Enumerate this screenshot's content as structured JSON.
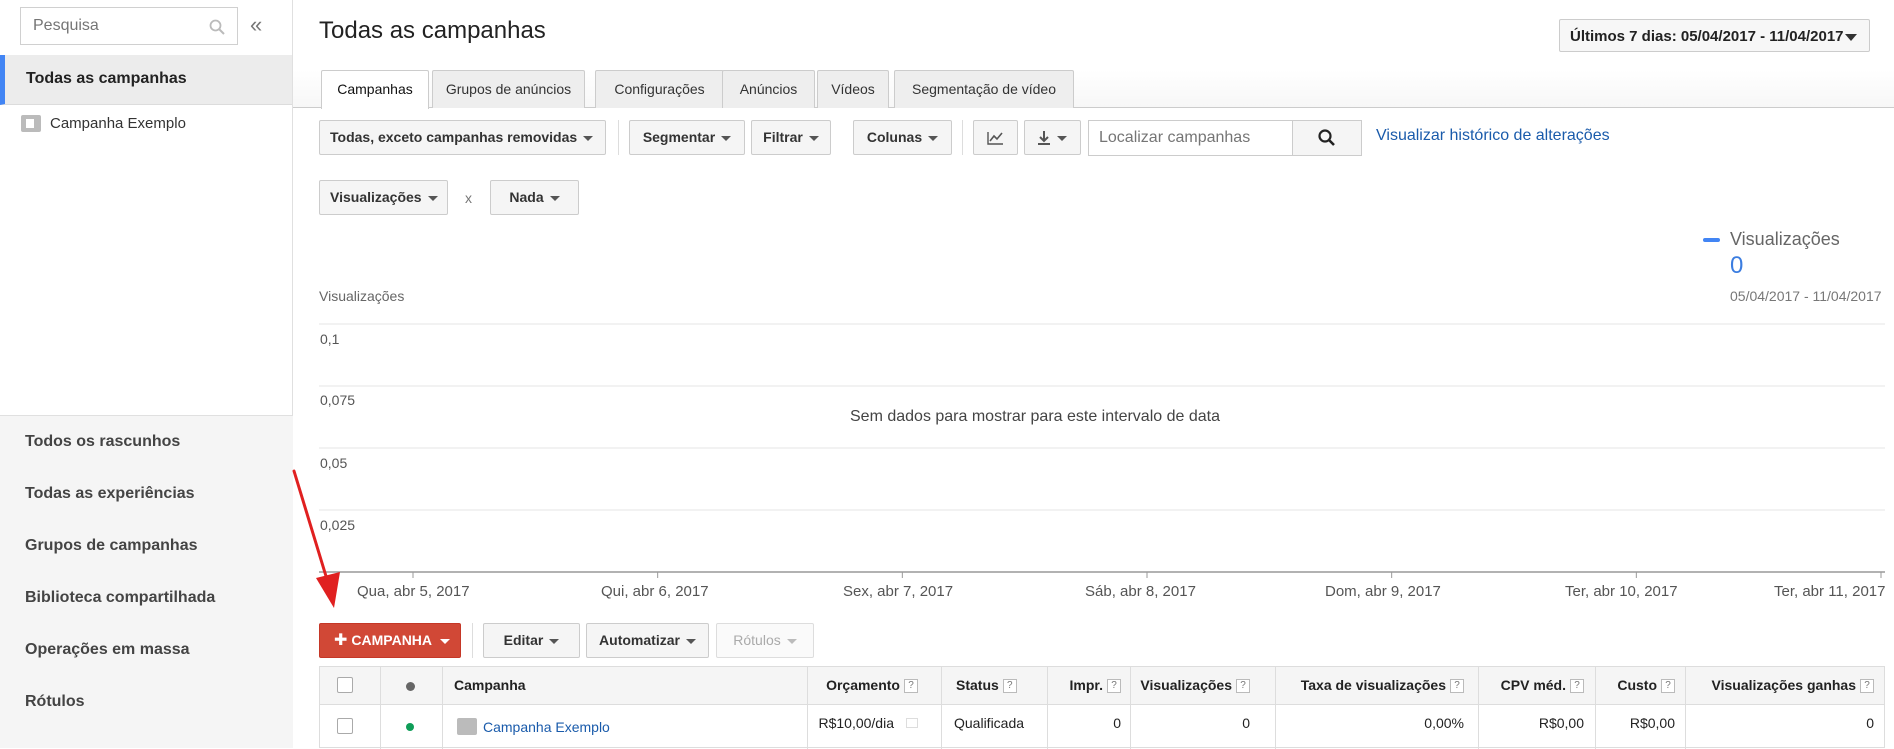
{
  "sidebar": {
    "search_placeholder": "Pesquisa",
    "collapse_glyph": "«",
    "active_item": "Todas as campanhas",
    "campaign_item": "Campanha Exemplo",
    "links": [
      "Todos os rascunhos",
      "Todas as experiências",
      "Grupos de campanhas",
      "Biblioteca compartilhada",
      "Operações em massa",
      "Rótulos"
    ]
  },
  "header": {
    "title": "Todas as campanhas",
    "date_range": "Últimos 7 dias: 05/04/2017 - 11/04/2017"
  },
  "tabs": [
    "Campanhas",
    "Grupos de anúncios",
    "Configurações",
    "Anúncios",
    "Vídeos",
    "Segmentação de vídeo"
  ],
  "toolbar": {
    "filter_status": "Todas, exceto campanhas removidas",
    "segment": "Segmentar",
    "filter": "Filtrar",
    "columns": "Colunas",
    "find_placeholder": "Localizar campanhas",
    "history_link": "Visualizar histórico de alterações"
  },
  "chart_controls": {
    "metric1": "Visualizações",
    "separator": "x",
    "metric2": "Nada"
  },
  "chart_data": {
    "type": "line",
    "ylabel": "Visualizações",
    "y_ticks": [
      "0,1",
      "0,075",
      "0,05",
      "0,025"
    ],
    "ylim": [
      0,
      0.1
    ],
    "x": [
      "Qua, abr 5, 2017",
      "Qui, abr 6, 2017",
      "Sex, abr 7, 2017",
      "Sáb, abr 8, 2017",
      "Dom, abr 9, 2017",
      "Ter, abr 10, 2017",
      "Ter, abr 11, 2017"
    ],
    "series": [],
    "message": "Sem dados para mostrar para este intervalo de data",
    "legend": {
      "name": "Visualizações",
      "value": "0",
      "dates": "05/04/2017 - 11/04/2017",
      "color": "#4285f4"
    },
    "grid": true
  },
  "actions": {
    "add_campaign": "CAMPANHA",
    "edit": "Editar",
    "automate": "Automatizar",
    "labels": "Rótulos"
  },
  "table": {
    "headers": {
      "campaign": "Campanha",
      "budget": "Orçamento",
      "status": "Status",
      "impr": "Impr.",
      "views": "Visualizações",
      "view_rate": "Taxa de visualizações",
      "avg_cpv": "CPV méd.",
      "cost": "Custo",
      "earned_views": "Visualizações ganhas"
    },
    "rows": [
      {
        "campaign": "Campanha Exemplo",
        "budget": "R$10,00/dia",
        "status": "Qualificada",
        "impr": "0",
        "views": "0",
        "view_rate": "0,00%",
        "avg_cpv": "R$0,00",
        "cost": "R$0,00",
        "earned_views": "0"
      }
    ]
  },
  "colors": {
    "accent": "#4285f4",
    "primary_button": "#d14836",
    "link": "#1a5bab",
    "status_enabled": "#0f9d58"
  }
}
